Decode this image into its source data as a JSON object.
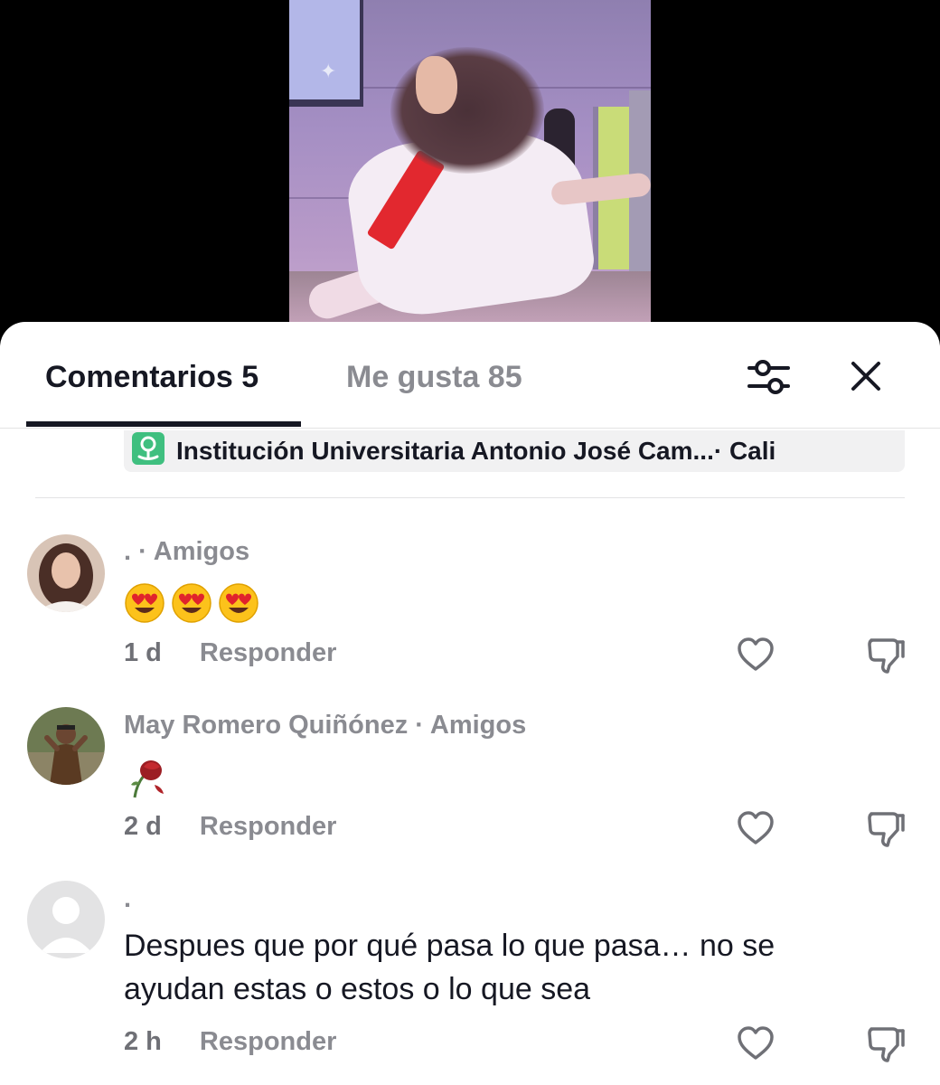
{
  "tabs": {
    "comments_label": "Comentarios 5",
    "likes_label": "Me gusta 85"
  },
  "location": {
    "text": "Institución Universitaria Antonio José Cam...· Cali"
  },
  "comments": [
    {
      "username": ". · Amigos",
      "content": "😍😍😍",
      "age": "1 d",
      "reply_label": "Responder"
    },
    {
      "username": "May Romero Quiñónez · Amigos",
      "content": "🥀",
      "age": "2 d",
      "reply_label": "Responder"
    },
    {
      "username": ".",
      "content": "Despues que por qué pasa lo que pasa… no se ayudan estas o estos o lo que sea",
      "age": "2 h",
      "reply_label": "Responder"
    }
  ],
  "icons": {
    "filter": "sliders-icon",
    "close": "close-icon",
    "location": "map-pin-icon",
    "like": "heart-outline-icon",
    "dislike": "thumbs-down-icon"
  },
  "colors": {
    "primary_text": "#161823",
    "secondary_text": "#8a8b91",
    "location_green": "#3fbf7f",
    "chip_bg": "#f1f1f2"
  }
}
